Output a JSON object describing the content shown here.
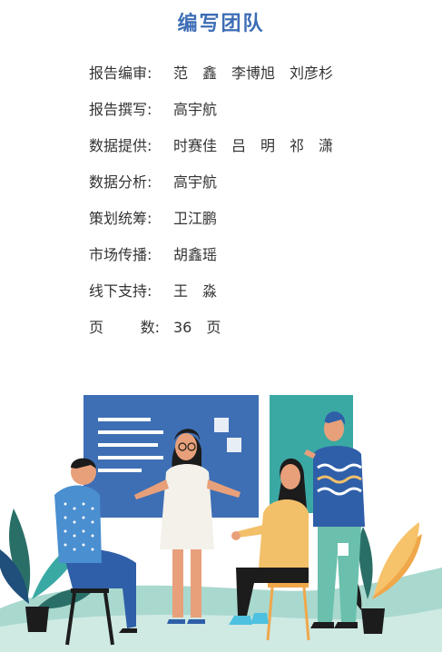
{
  "title": "编写团队",
  "credits": [
    {
      "label": "报告编审:",
      "value": "范　鑫　李博旭　刘彦杉"
    },
    {
      "label": "报告撰写:",
      "value": "高宇航"
    },
    {
      "label": "数据提供:",
      "value": "时赛佳　吕　明　祁　潇"
    },
    {
      "label": "数据分析:",
      "value": "高宇航"
    },
    {
      "label": "策划统筹:",
      "value": "卫江鹏"
    },
    {
      "label": "市场传播:",
      "value": "胡鑫瑶"
    },
    {
      "label": "线下支持:",
      "value": "王　淼"
    }
  ],
  "pages": {
    "label_left": "页",
    "label_right": "数:",
    "value": "36　页"
  },
  "colors": {
    "title": "#3d6db5",
    "board_left": "#3e6fb4",
    "board_right": "#3aa9a4",
    "ground": "#a9d8cf"
  }
}
